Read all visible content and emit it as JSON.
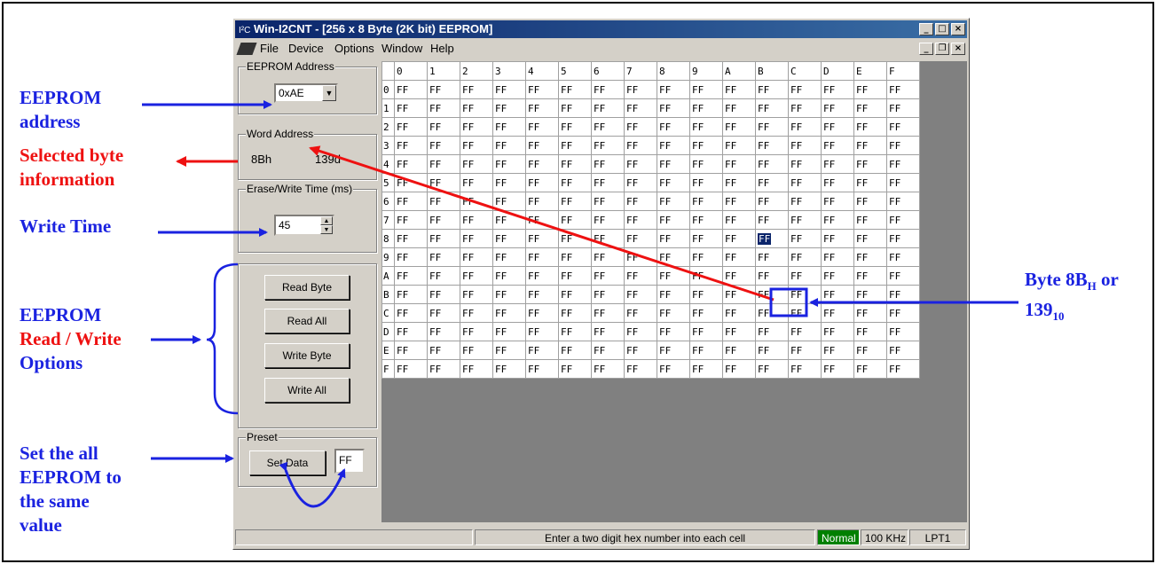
{
  "annotations": {
    "eeprom_address": [
      "EEPROM",
      "address"
    ],
    "selected_byte": [
      "Selected byte",
      "information"
    ],
    "write_time": "Write Time",
    "rw_options": [
      "EEPROM",
      "Read / Write",
      "Options"
    ],
    "set_all": [
      "Set the all",
      "EEPROM to",
      "the same",
      "value"
    ],
    "byte_label_main": "Byte 8B",
    "byte_label_sub1": "H",
    "byte_label_or": " or",
    "byte_label_num": "139",
    "byte_label_sub2": "10"
  },
  "window": {
    "title": "Win-I2CNT - [256 x 8 Byte (2K bit) EEPROM]",
    "title_prefix": "I²C"
  },
  "menu": {
    "items": [
      "File",
      "Device",
      "Options",
      "Window",
      "Help"
    ]
  },
  "panel": {
    "eeprom_address_label": "EEPROM Address",
    "eeprom_address_value": "0xAE",
    "word_address_label": "Word Address",
    "word_address_hex": "8Bh",
    "word_address_dec": "139d",
    "erase_write_label": "Erase/Write Time (ms)",
    "erase_write_value": "45",
    "read_byte": "Read Byte",
    "read_all": "Read All",
    "write_byte": "Write Byte",
    "write_all": "Write All",
    "preset_label": "Preset",
    "set_data": "Set Data",
    "preset_value": "FF"
  },
  "grid": {
    "columns": [
      "0",
      "1",
      "2",
      "3",
      "4",
      "5",
      "6",
      "7",
      "8",
      "9",
      "A",
      "B",
      "C",
      "D",
      "E",
      "F"
    ],
    "rows": [
      "0",
      "1",
      "2",
      "3",
      "4",
      "5",
      "6",
      "7",
      "8",
      "9",
      "A",
      "B",
      "C",
      "D",
      "E",
      "F"
    ],
    "cell_value": "FF",
    "selected_row": 8,
    "selected_col": 11
  },
  "status": {
    "message": "Enter a two digit hex number into each cell",
    "mode": "Normal",
    "speed": "100 KHz",
    "port": "LPT1"
  },
  "colors": {
    "annotation_blue": "#1a22e0",
    "annotation_red": "#ee1111",
    "status_normal_bg": "#008000"
  }
}
